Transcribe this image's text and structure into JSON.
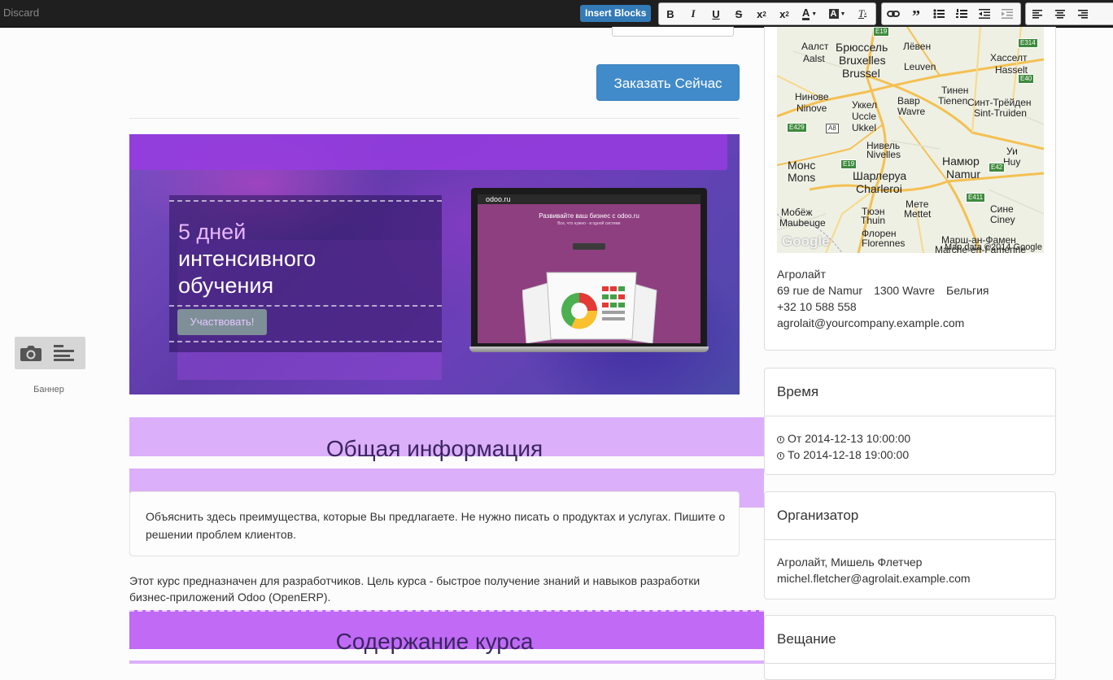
{
  "toolbar": {
    "discard": "Discard",
    "insert_blocks": "Insert Blocks",
    "format_buttons": [
      "bold",
      "italic",
      "underline",
      "strikethrough",
      "subscript",
      "superscript",
      "font-color",
      "highlight-color",
      "clear-format"
    ],
    "list_buttons": [
      "link",
      "blockquote",
      "bulleted-list",
      "numbered-list",
      "outdent",
      "indent"
    ],
    "align_buttons": [
      "align-left",
      "align-center",
      "align-right"
    ]
  },
  "snippet": {
    "label": "Баннер"
  },
  "main": {
    "order_button": "Заказать Сейчас",
    "banner": {
      "title_accent": "5 дней",
      "title_rest": "интенсивного обучения",
      "button": "Участвовать!",
      "screen_logo": "odoo.ru",
      "screen_headline": "Развивайте ваш бизнес с odoo.ru",
      "screen_sub": "Все, что нужно - в одной системе"
    },
    "section1_title": "Общая информация",
    "info_text": "Объяснить здесь преимущества, которые Вы предлагаете. Не нужно писать о продуктах и услугах. Пишите о решении проблем клиентов.",
    "body_text": "Этот курс предназначен для разработчиков. Цель курса - быстрое получение знаний и навыков разработки бизнес-приложений Odoo (OpenERP).",
    "section2_title": "Содержание курса"
  },
  "sidebar": {
    "map": {
      "attribution": "Map data ©2014 Google",
      "logo": "Google",
      "cities": [
        {
          "name": "Брюссель",
          "big": true
        },
        {
          "name": "Bruxelles",
          "big": true
        },
        {
          "name": "Brussel",
          "big": true
        },
        {
          "name": "Лёвен"
        },
        {
          "name": "Leuven"
        },
        {
          "name": "Хасселт"
        },
        {
          "name": "Hasselt"
        },
        {
          "name": "Аалст"
        },
        {
          "name": "Aalst"
        },
        {
          "name": "Нинове"
        },
        {
          "name": "Ninove"
        },
        {
          "name": "Уккел"
        },
        {
          "name": "Uccle"
        },
        {
          "name": "Ukkel"
        },
        {
          "name": "Вавр"
        },
        {
          "name": "Wavre"
        },
        {
          "name": "Тинен"
        },
        {
          "name": "Tienen"
        },
        {
          "name": "Синт-Трёйден"
        },
        {
          "name": "Sint-Truiden"
        },
        {
          "name": "Нивель"
        },
        {
          "name": "Nivelles"
        },
        {
          "name": "Монс",
          "big": true
        },
        {
          "name": "Mons",
          "big": true
        },
        {
          "name": "Шарлеруа",
          "big": true
        },
        {
          "name": "Charleroi",
          "big": true
        },
        {
          "name": "Намюр",
          "big": true
        },
        {
          "name": "Namur",
          "big": true
        },
        {
          "name": "Уи"
        },
        {
          "name": "Huy"
        },
        {
          "name": "Мобёж"
        },
        {
          "name": "Maubeuge"
        },
        {
          "name": "Тюэн"
        },
        {
          "name": "Thuin"
        },
        {
          "name": "Мете"
        },
        {
          "name": "Mettet"
        },
        {
          "name": "Сине"
        },
        {
          "name": "Ciney"
        },
        {
          "name": "Флорен"
        },
        {
          "name": "Florennes"
        },
        {
          "name": "Марш-ан-Фамен"
        },
        {
          "name": "Marche-en-Famenne"
        }
      ],
      "shields": [
        "E19",
        "E314",
        "E40",
        "E429",
        "A8",
        "E19",
        "E42",
        "E411"
      ]
    },
    "address": {
      "company": "Агролайт",
      "street": "69 rue de Namur",
      "city": "1300 Wavre",
      "country": "Бельгия",
      "phone": "+32 10 588 558",
      "email": "agrolait@yourcompany.example.com"
    },
    "time": {
      "title": "Время",
      "from": "От 2014-12-13 10:00:00",
      "to": "То 2014-12-18 19:00:00"
    },
    "organizer": {
      "title": "Организатор",
      "names": "Агролайт, Мишель Флетчер",
      "email": "michel.fletcher@agrolait.example.com"
    },
    "broadcast": {
      "title": "Вещание"
    }
  }
}
